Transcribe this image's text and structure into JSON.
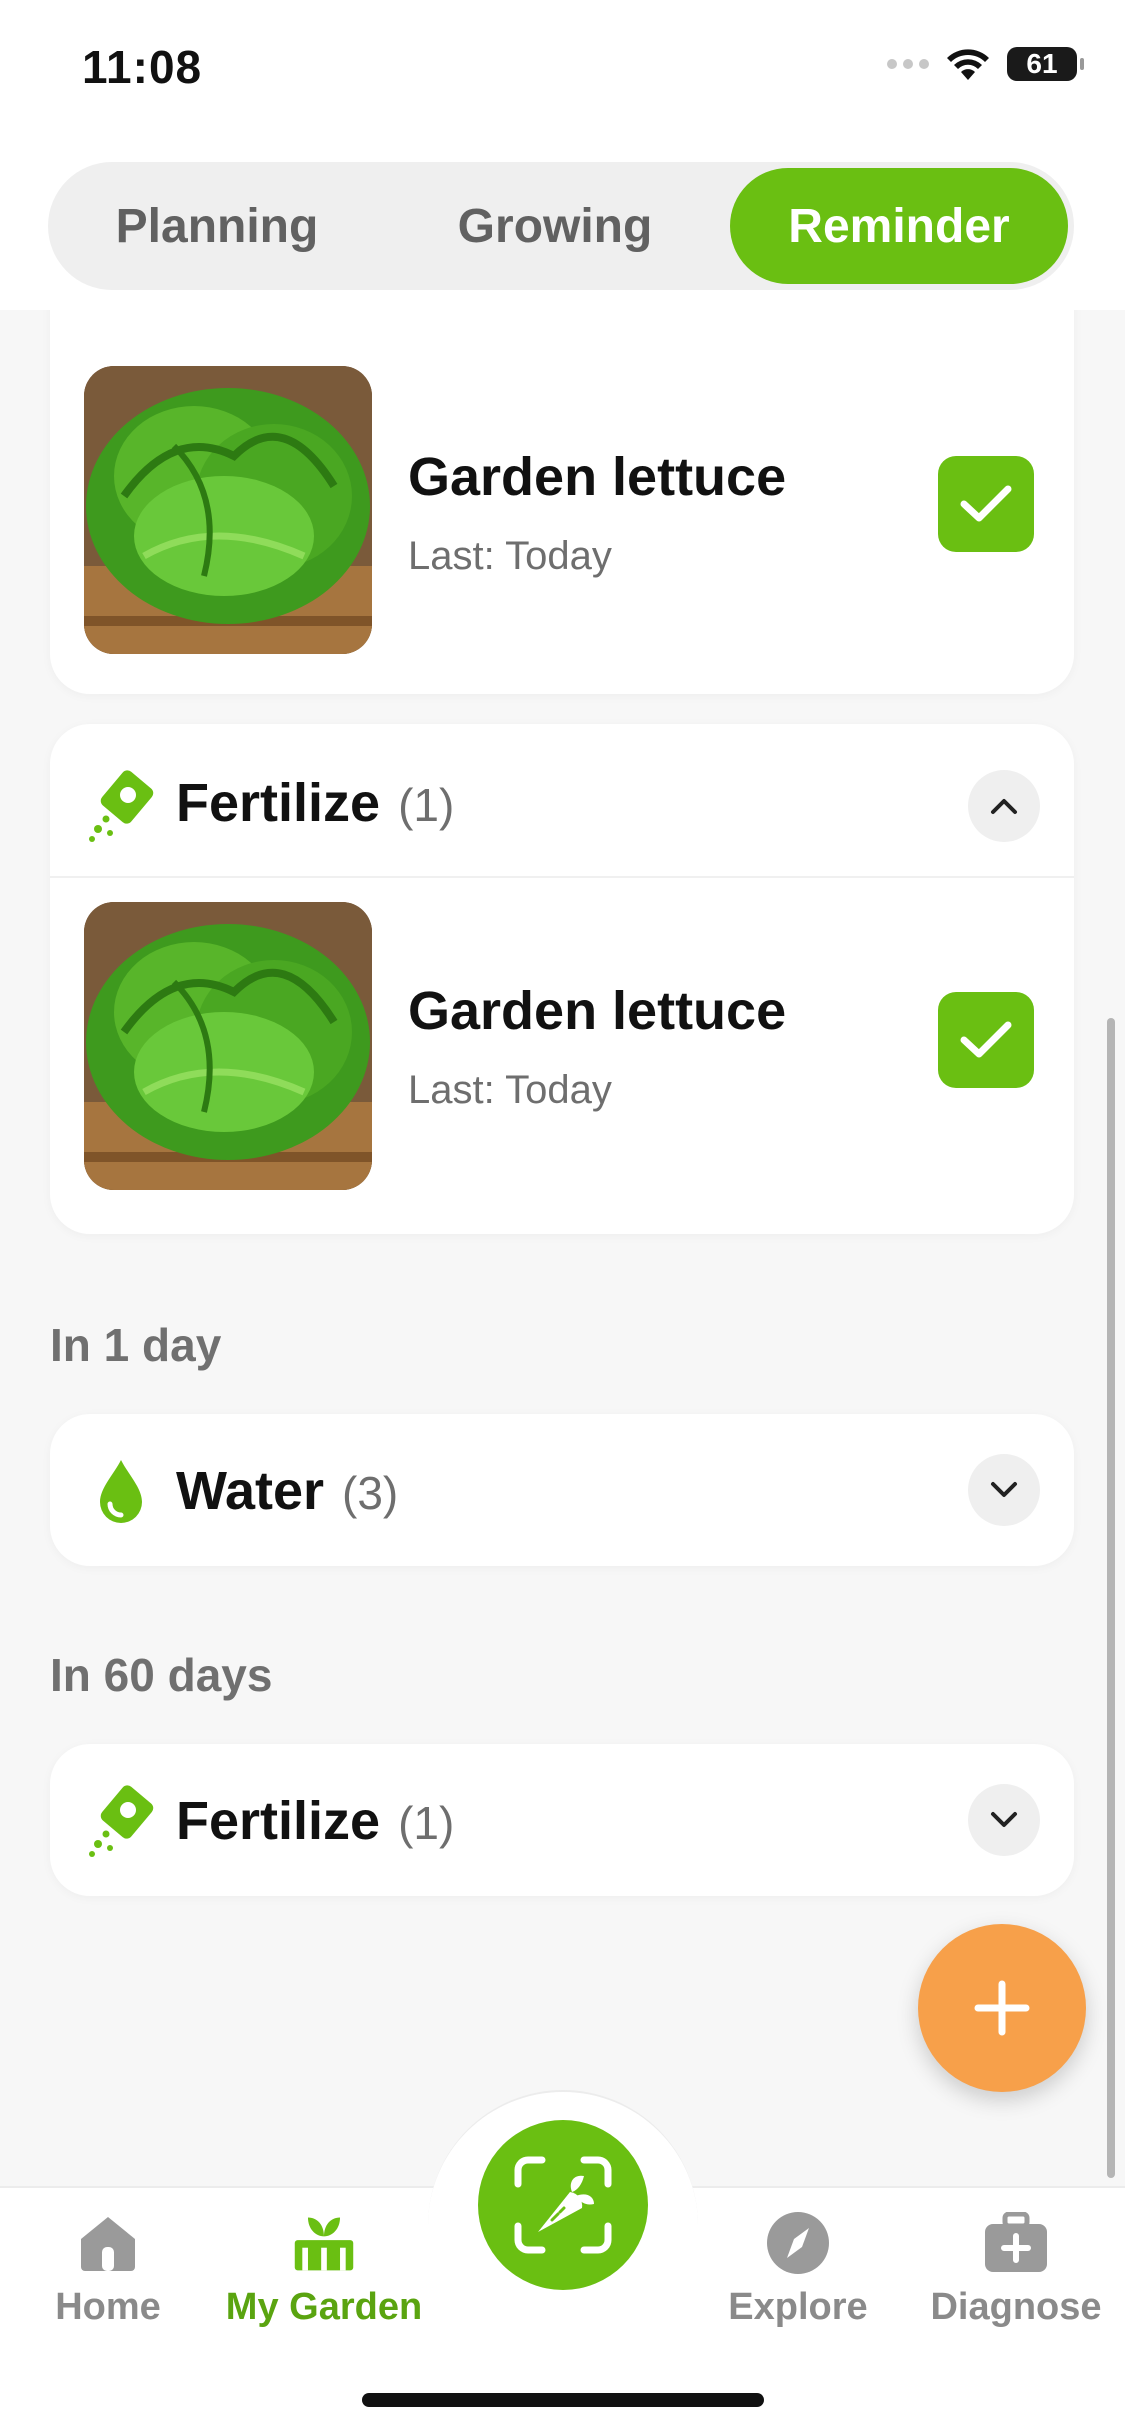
{
  "status_bar": {
    "time": "11:08",
    "battery": "61"
  },
  "segments": [
    {
      "label": "Planning",
      "active": false
    },
    {
      "label": "Growing",
      "active": false
    },
    {
      "label": "Reminder",
      "active": true
    }
  ],
  "today_water_card": {
    "plant": {
      "name": "Garden lettuce",
      "last": "Last: Today"
    }
  },
  "today_fertilize_card": {
    "title": "Fertilize",
    "count": "(1)",
    "plant": {
      "name": "Garden lettuce",
      "last": "Last: Today"
    }
  },
  "sections": [
    {
      "label": "In 1 day",
      "group": {
        "title": "Water",
        "count": "(3)",
        "icon": "water-drop-icon"
      }
    },
    {
      "label": "In 60 days",
      "group": {
        "title": "Fertilize",
        "count": "(1)",
        "icon": "fertilizer-icon"
      }
    }
  ],
  "tabbar": {
    "items": [
      {
        "label": "Home",
        "icon": "home-icon",
        "active": false
      },
      {
        "label": "My Garden",
        "icon": "garden-icon",
        "active": true
      },
      {
        "label": "Explore",
        "icon": "compass-icon",
        "active": false
      },
      {
        "label": "Diagnose",
        "icon": "medkit-icon",
        "active": false
      }
    ]
  },
  "colors": {
    "accent": "#6abf12",
    "fab": "#f7a04a",
    "muted_text": "#6e6e6e"
  }
}
